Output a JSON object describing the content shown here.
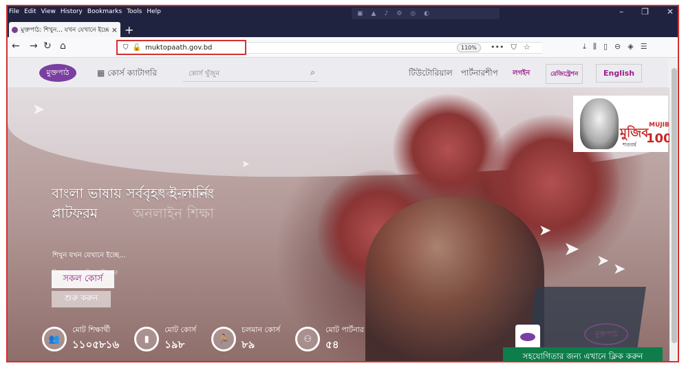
{
  "menu": [
    "File",
    "Edit",
    "View",
    "History",
    "Bookmarks",
    "Tools",
    "Help"
  ],
  "tab": {
    "title": "মুক্তপাঠ: শিখুন... যখন যেখানে ইচ্ছে",
    "close": "×"
  },
  "newtab": "+",
  "url": "muktopaath.gov.bd",
  "zoom": "110%",
  "site": {
    "logo_text": "মুক্তপাঠ",
    "category": "কোর্স ক্যাটাগরি",
    "search_placeholder": "কোর্স খুঁজুন",
    "nav": [
      "টিউটোরিয়াল",
      "পার্টনারশীপ"
    ],
    "login": "লগইন",
    "register": "রেজিস্ট্রেশন",
    "language": "English"
  },
  "hero": {
    "title": "বাংলা ভাষায় সর্ববৃহৎ ই-লার্নিং প্লাটফরম",
    "ghost_title": "সবার জন্য অনলাইন শিক্ষা",
    "tagline": "শিখুন যখন যেখানে ইচ্ছে...",
    "subtext": "বিজ্ঞান ও প্রযুক্তি অধিদপ্তর",
    "btn_all": "সকল কোর্স",
    "btn_start": "শুরু করুন"
  },
  "stats": [
    {
      "label": "মোট শিক্ষার্থী",
      "value": "১১০৫৮১৬",
      "icon": "users-icon"
    },
    {
      "label": "মোট কোর্স",
      "value": "১৯৮",
      "icon": "book-icon"
    },
    {
      "label": "চলমান কোর্স",
      "value": "৮৯",
      "icon": "running-icon"
    },
    {
      "label": "মোট পার্টনার",
      "value": "৫৪",
      "icon": "partners-icon"
    }
  ],
  "mujib": {
    "title": "মুজিব",
    "sub": "MUJIB",
    "num": "100",
    "caption": "শতবর্ষ"
  },
  "help_button": "সহযোগিতার জন্য এখানে ক্লিক করুন",
  "colors": {
    "brand": "#9c1c8a",
    "help": "#0d7d4a",
    "titlebar": "#202340"
  }
}
